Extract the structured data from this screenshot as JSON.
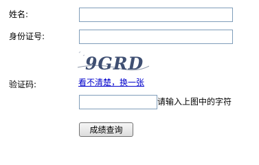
{
  "form": {
    "name_label": "姓名:",
    "name_value": "",
    "id_label": "身份证号:",
    "id_value": "",
    "captcha_label": "验证码:",
    "captcha_image_text": "9GRD",
    "captcha_refresh_link": "看不清楚，换一张",
    "captcha_value": "",
    "captcha_hint": "请输入上图中的字符",
    "submit_label": "成绩查询"
  },
  "colors": {
    "link": "#0000cc",
    "captcha_text": "#3f4f72",
    "input_border": "#7f9db9"
  }
}
